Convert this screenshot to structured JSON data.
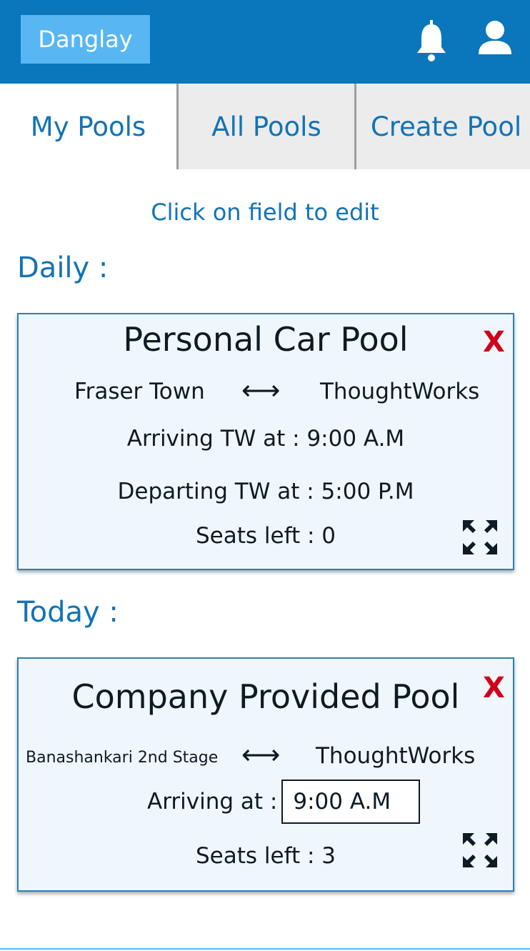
{
  "header": {
    "brand": "Danglay",
    "bell_icon": "bell-icon",
    "user_icon": "user-icon",
    "accent_color": "#0a76bb"
  },
  "tabs": [
    {
      "label": "My Pools",
      "active": true
    },
    {
      "label": "All Pools",
      "active": false
    },
    {
      "label": "Create Pool",
      "active": false
    }
  ],
  "hint": "Click on field to edit",
  "sections": {
    "daily_label": "Daily :",
    "today_label": "Today :"
  },
  "daily_pool": {
    "title": "Personal Car Pool",
    "close": "X",
    "from": "Fraser Town",
    "arrow": "⟷",
    "to": "ThoughtWorks",
    "arriving": "Arriving TW at : 9:00 A.M",
    "departing": "Departing TW at : 5:00 P.M",
    "seats": "Seats left : 0",
    "expand_icon": "expand-icon"
  },
  "today_pool": {
    "title": "Company Provided Pool",
    "close": "X",
    "from": "Banashankari 2nd Stage",
    "arrow": "⟷",
    "to": "ThoughtWorks",
    "arriving_label": "Arriving at :",
    "arriving_value": "9:00 A.M",
    "seats": "Seats left : 3",
    "expand_icon": "expand-icon"
  }
}
